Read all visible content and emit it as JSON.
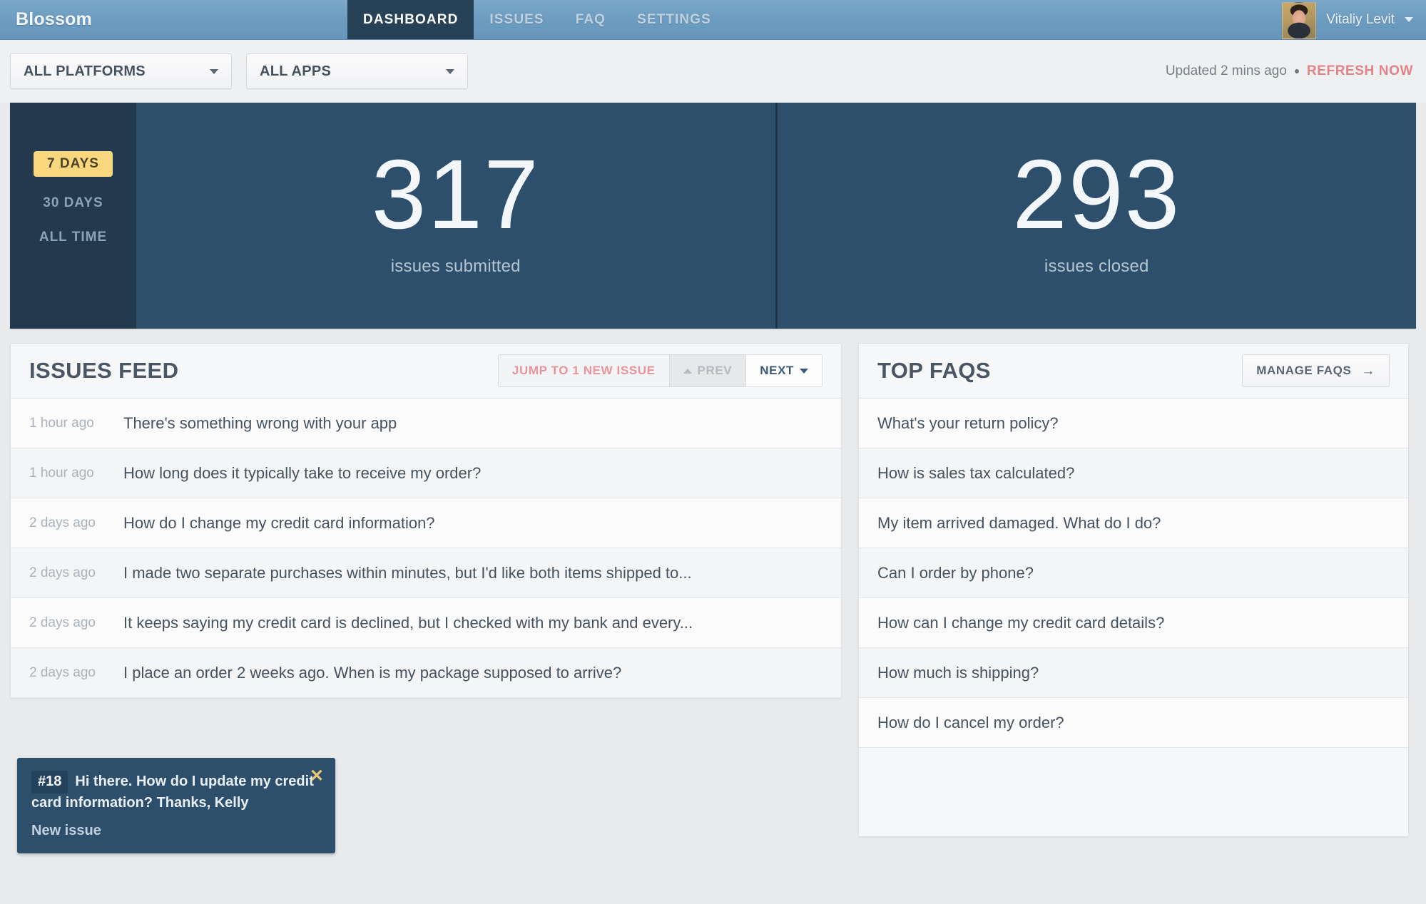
{
  "header": {
    "brand": "Blossom",
    "nav": [
      {
        "label": "DASHBOARD",
        "active": true
      },
      {
        "label": "ISSUES",
        "active": false
      },
      {
        "label": "FAQ",
        "active": false
      },
      {
        "label": "SETTINGS",
        "active": false
      }
    ],
    "user": {
      "name": "Vitaliy Levit"
    }
  },
  "filters": {
    "platform": {
      "value": "ALL PLATFORMS"
    },
    "app": {
      "value": "ALL APPS"
    },
    "updated_text": "Updated 2 mins ago",
    "refresh_label": "REFRESH NOW"
  },
  "stats": {
    "timeframes": [
      {
        "label": "7 DAYS",
        "active": true
      },
      {
        "label": "30 DAYS",
        "active": false
      },
      {
        "label": "ALL TIME",
        "active": false
      }
    ],
    "cards": [
      {
        "value": "317",
        "label": "issues submitted"
      },
      {
        "value": "293",
        "label": "issues closed"
      }
    ]
  },
  "feed": {
    "title": "ISSUES FEED",
    "jump_label": "JUMP TO 1 NEW ISSUE",
    "prev_label": "PREV",
    "next_label": "NEXT",
    "items": [
      {
        "time": "1 hour ago",
        "text": "There's something wrong with your app"
      },
      {
        "time": "1 hour ago",
        "text": "How long does it typically take to receive my order?"
      },
      {
        "time": "2 days ago",
        "text": "How do I change my credit card information?"
      },
      {
        "time": "2 days ago",
        "text": "I made two separate purchases within minutes, but I'd like both items shipped to..."
      },
      {
        "time": "2 days ago",
        "text": "It keeps saying my credit card is declined, but I checked with my bank and every..."
      },
      {
        "time": "2 days ago",
        "text": "I place an order 2 weeks ago. When is my package supposed to arrive?"
      }
    ]
  },
  "faqs": {
    "title": "TOP FAQS",
    "manage_label": "MANAGE FAQS",
    "items": [
      {
        "text": "What's your return policy?"
      },
      {
        "text": "How is sales tax calculated?"
      },
      {
        "text": "My item arrived damaged. What do I do?"
      },
      {
        "text": "Can I order by phone?"
      },
      {
        "text": "How can I change my credit card details?"
      },
      {
        "text": "How much is shipping?"
      },
      {
        "text": "How do I cancel my order?"
      }
    ]
  },
  "toast": {
    "id": "#18",
    "message": "Hi there. How do I update my credit card information? Thanks, Kelly",
    "subtitle": "New issue",
    "close_glyph": "✕"
  },
  "colors": {
    "header_blue": "#6d9cc0",
    "active_tab": "#274257",
    "panel_navy": "#2d4f6b",
    "sidebar_navy": "#233a4e",
    "accent_yellow": "#f8d77e",
    "accent_salmon": "#e2838a",
    "text_dark": "#46525e"
  }
}
